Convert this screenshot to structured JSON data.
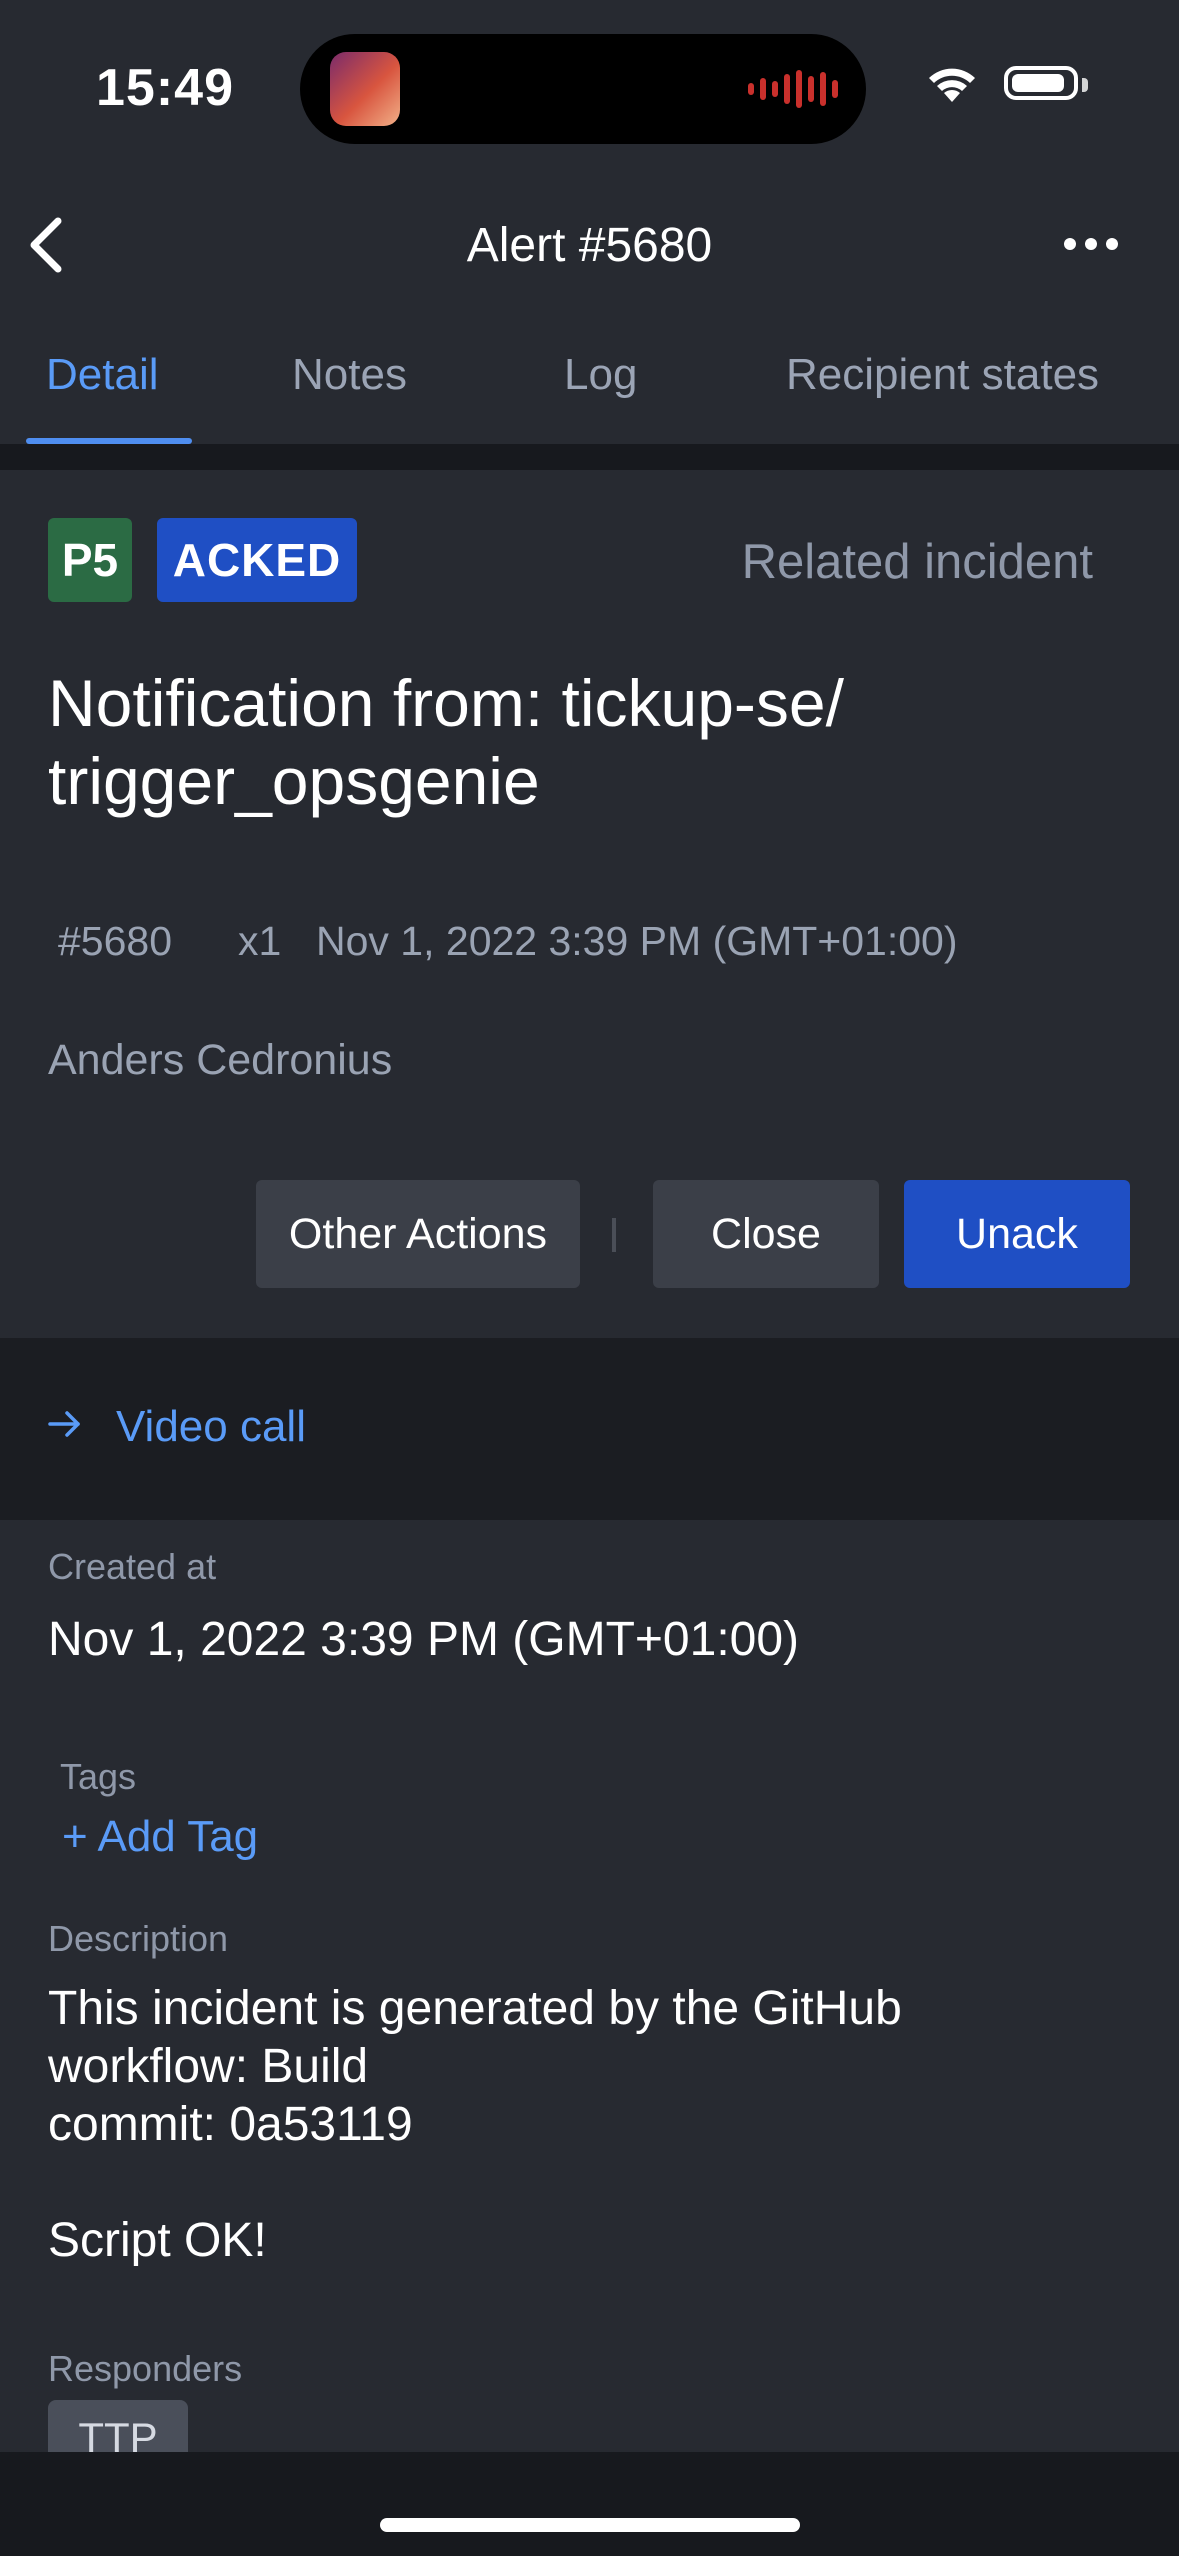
{
  "status_bar": {
    "time": "15:49"
  },
  "nav": {
    "title": "Alert #5680"
  },
  "tabs": [
    {
      "label": "Detail",
      "active": true
    },
    {
      "label": "Notes",
      "active": false
    },
    {
      "label": "Log",
      "active": false
    },
    {
      "label": "Recipient states",
      "active": false
    }
  ],
  "alert": {
    "priority": "P5",
    "status": "ACKED",
    "related_link": "Related incident",
    "title": "Notification from: tickup-se/ trigger_opsgenie",
    "tiny_id": "#5680",
    "count": "x1",
    "created": "Nov 1, 2022 3:39 PM (GMT+01:00)",
    "owner": "Anders Cedronius"
  },
  "actions": {
    "other_label": "Other Actions",
    "close_label": "Close",
    "unack_label": "Unack"
  },
  "video_call": {
    "label": "Video call"
  },
  "details": {
    "created_label": "Created at",
    "created_value": "Nov 1, 2022 3:39 PM (GMT+01:00)",
    "tags_label": "Tags",
    "add_tag": "+ Add Tag",
    "description_label": "Description",
    "description": "This incident is generated by the GitHub\nworkflow: Build\ncommit: 0a53119\n\nScript OK!",
    "responders_label": "Responders",
    "responders": [
      "TTP"
    ]
  },
  "colors": {
    "background": "#272a31",
    "accent": "#4f8ef0",
    "priority_p5": "#2b6b44",
    "acked": "#1f4fc4"
  },
  "icons": [
    "back-chevron-icon",
    "more-dots-icon",
    "wifi-icon",
    "battery-icon",
    "arrow-right-icon"
  ]
}
